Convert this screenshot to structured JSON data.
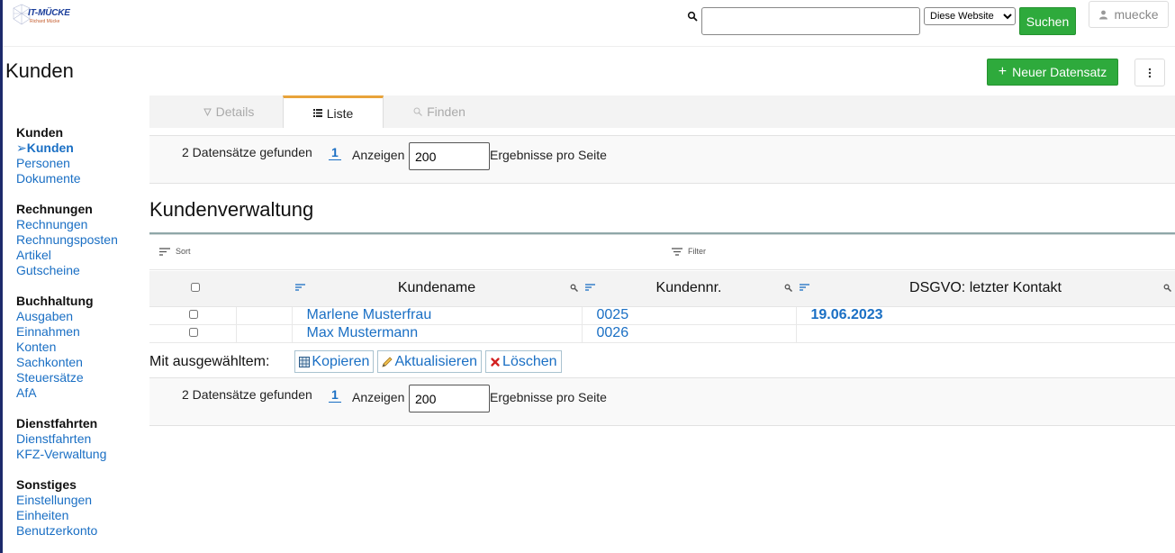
{
  "header": {
    "logo_text": "IT-MÜCKE",
    "logo_sub": "Richard Mücke",
    "search_value": "",
    "scope_selected": "Diese Website",
    "search_button": "Suchen",
    "user_name": "muecke"
  },
  "page": {
    "title": "Kunden",
    "new_record_label": "Neuer Datensatz"
  },
  "sidebar": {
    "groups": [
      {
        "heading": "Kunden",
        "items": [
          "➢Kunden",
          "Personen",
          "Dokumente"
        ]
      },
      {
        "heading": "Rechnungen",
        "items": [
          "Rechnungen",
          "Rechnungsposten",
          "Artikel",
          "Gutscheine"
        ]
      },
      {
        "heading": "Buchhaltung",
        "items": [
          "Ausgaben",
          "Einnahmen",
          "Konten",
          "Sachkonten",
          "Steuersätze",
          "AfA"
        ]
      },
      {
        "heading": "Dienstfahrten",
        "items": [
          "Dienstfahrten",
          "KFZ-Verwaltung"
        ]
      },
      {
        "heading": "Sonstiges",
        "items": [
          "Einstellungen",
          "Einheiten",
          "Benutzerkonto"
        ]
      }
    ]
  },
  "tabs": [
    "Details",
    "Liste",
    "Finden"
  ],
  "pager": {
    "found": "2 Datensätze gefunden",
    "page": "1",
    "show_label": "Anzeigen",
    "per_page_value": "200",
    "per_page_label": "Ergebnisse pro Seite"
  },
  "section_title": "Kundenverwaltung",
  "toolbar": {
    "sort_label": "Sort",
    "filter_label": "Filter"
  },
  "table": {
    "columns": [
      "Kundename",
      "Kundennr.",
      "DSGVO: letzter Kontakt"
    ],
    "rows": [
      {
        "name": "Marlene Musterfrau",
        "nr": "0025",
        "date": "19.06.2023"
      },
      {
        "name": "Max Mustermann",
        "nr": "0026",
        "date": ""
      }
    ]
  },
  "bulk": {
    "label": "Mit ausgewähltem:",
    "copy": "Kopieren",
    "update": "Aktualisieren",
    "delete": "Löschen"
  },
  "colors": {
    "accent_green": "#2eaa3c",
    "link_blue": "#1a6fc4",
    "tab_active": "#e8a33a"
  }
}
